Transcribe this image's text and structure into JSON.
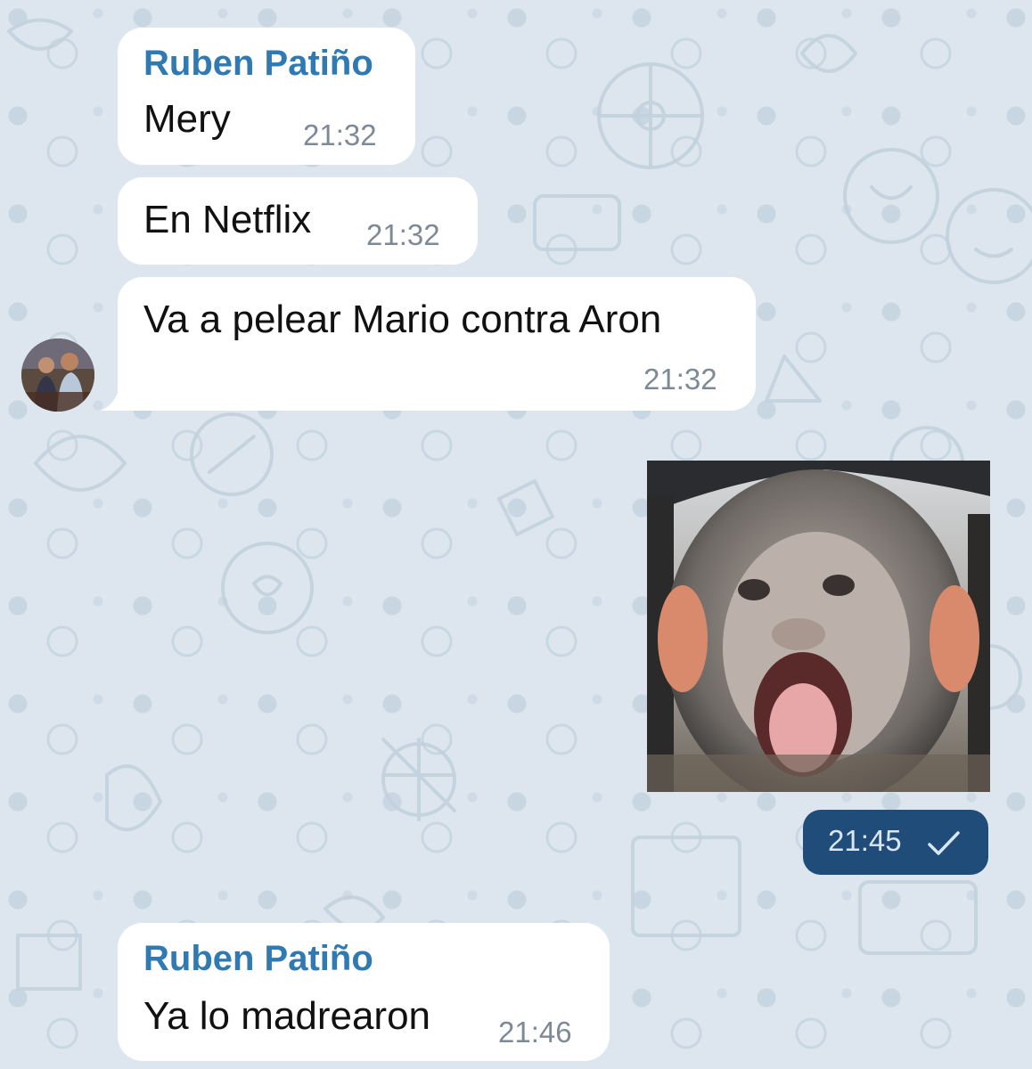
{
  "colors": {
    "sender_name": "#2f7ab3",
    "incoming_bubble": "#ffffff",
    "outgoing_badge": "#1f4c78",
    "wallpaper": "#dde6ee"
  },
  "messages": [
    {
      "sender": "Ruben Patiño",
      "text": "Mery",
      "time": "21:32"
    },
    {
      "text": "En Netflix",
      "time": "21:32"
    },
    {
      "text": "Va a pelear Mario contra Aron",
      "time": "21:32"
    },
    {
      "type": "image",
      "image_description": "baby monkey with mouth open",
      "time": "21:45",
      "status_icon": "single-check-icon"
    },
    {
      "sender": "Ruben Patiño",
      "text": "Ya lo madrearon",
      "time": "21:46"
    }
  ]
}
